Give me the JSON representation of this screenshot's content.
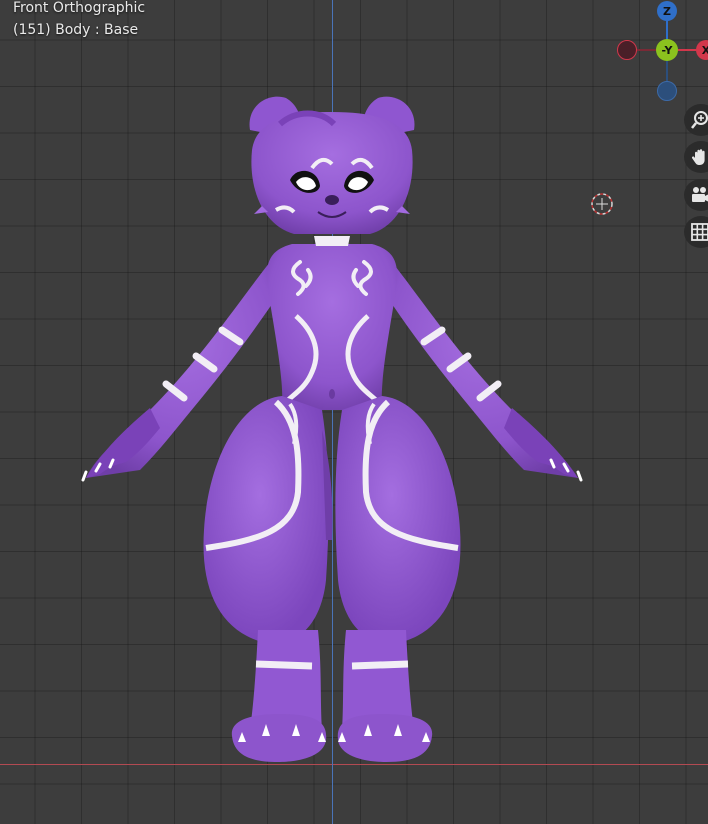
{
  "viewport": {
    "view_name": "Front Orthographic",
    "object_info": "(151) Body : Base"
  },
  "gizmo": {
    "up_axis": "Z",
    "center_axis": "-Y",
    "right_axis": "X",
    "colors": {
      "z": "#2f6fc9",
      "y": "#8bc21e",
      "x": "#d2374b",
      "neg": "#4a1f28",
      "negz": "#2c4f7c"
    }
  },
  "navigation": {
    "buttons": [
      {
        "name": "zoom-button",
        "icon": "magnifier-plus-icon"
      },
      {
        "name": "pan-button",
        "icon": "hand-icon"
      },
      {
        "name": "camera-view-button",
        "icon": "camera-icon"
      },
      {
        "name": "ortho-toggle-button",
        "icon": "grid-icon"
      }
    ]
  },
  "scene": {
    "character_color": "#9058d0",
    "marking_color": "#f2eef5"
  }
}
